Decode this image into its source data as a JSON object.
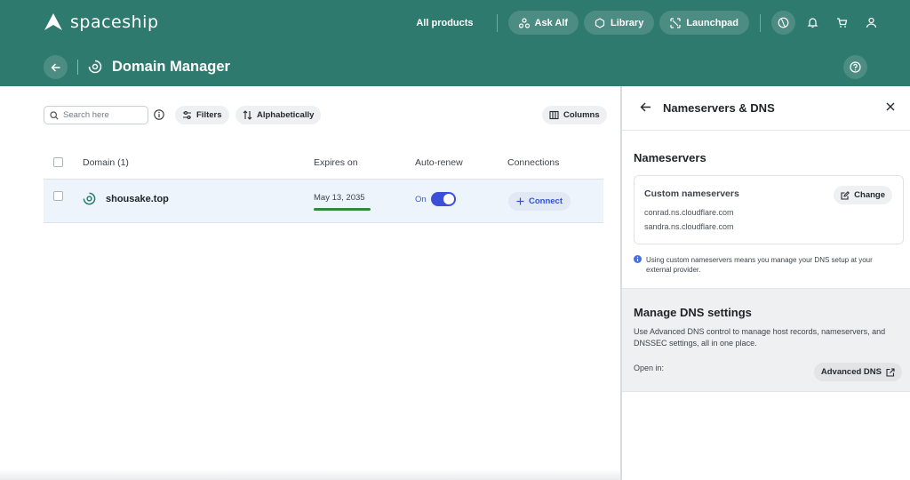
{
  "brand": {
    "name": "spaceship"
  },
  "nav": {
    "all_products": "All products",
    "ask_alf": "Ask Alf",
    "library": "Library",
    "launchpad": "Launchpad"
  },
  "page": {
    "title": "Domain Manager"
  },
  "toolbar": {
    "search_placeholder": "Search here",
    "filters": "Filters",
    "sort": "Alphabetically",
    "columns": "Columns"
  },
  "table": {
    "headers": {
      "domain": "Domain (1)",
      "expires": "Expires on",
      "autorenew": "Auto-renew",
      "connections": "Connections"
    },
    "rows": [
      {
        "domain": "shousake.top",
        "expires": "May 13, 2035",
        "expires_progress": 1.0,
        "autorenew_label": "On",
        "autorenew": true,
        "connect_label": "Connect"
      }
    ]
  },
  "panel": {
    "title": "Nameservers & DNS",
    "nameservers": {
      "title": "Nameservers",
      "card_label": "Custom nameservers",
      "change_label": "Change",
      "servers": [
        "conrad.ns.cloudflare.com",
        "sandra.ns.cloudflare.com"
      ],
      "note": "Using custom nameservers means you manage your DNS setup at your external provider."
    },
    "dns": {
      "title": "Manage DNS settings",
      "description": "Use Advanced DNS control to manage host records, nameservers, and DNSSEC settings, all in one place.",
      "open_in": "Open in:",
      "advanced_label": "Advanced DNS"
    }
  },
  "colors": {
    "header_bg": "#2f7a6e",
    "accent_blue": "#3b50d8",
    "progress_green": "#2e8b3d"
  }
}
